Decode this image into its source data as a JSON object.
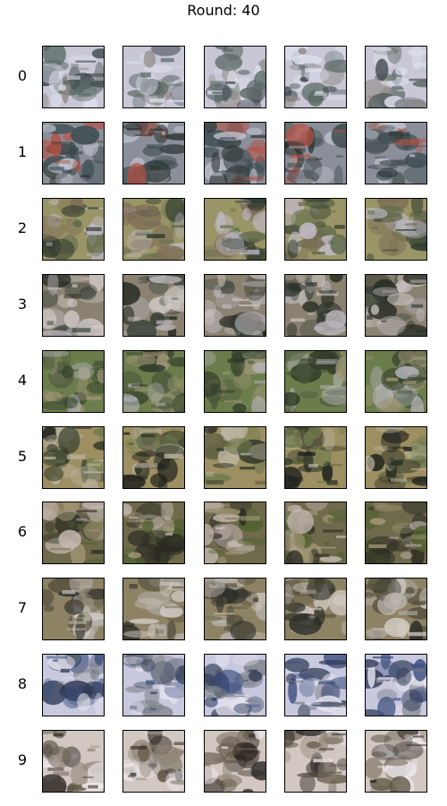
{
  "title": "Round: 40",
  "row_labels": [
    "0",
    "1",
    "2",
    "3",
    "4",
    "5",
    "6",
    "7",
    "8",
    "9"
  ],
  "columns": 5,
  "row_palettes": [
    [
      "#c9c6d6",
      "#3f4a4e",
      "#8f8a86",
      "#dfe2ee",
      "#5a6a66"
    ],
    [
      "#8b8f9a",
      "#3b4b4f",
      "#c8ccd8",
      "#2d3634",
      "#b65043"
    ],
    [
      "#9a9566",
      "#5e6a4a",
      "#c3bccb",
      "#7d6d58",
      "#2f3a2e"
    ],
    [
      "#8a8171",
      "#37423a",
      "#b8b3b8",
      "#262b22",
      "#cfc8c4"
    ],
    [
      "#6c7d4c",
      "#2f3b28",
      "#9e9576",
      "#48553a",
      "#b9b8c0"
    ],
    [
      "#9d8f61",
      "#2f3628",
      "#bdb5a2",
      "#1c1e1c",
      "#6e7a4d"
    ],
    [
      "#6f6a4b",
      "#2a2a22",
      "#a39777",
      "#51612f",
      "#c7b9b3"
    ],
    [
      "#8d8264",
      "#2b2d28",
      "#b7b1ad",
      "#55503d",
      "#d2cbc4"
    ],
    [
      "#c8c8de",
      "#3d4f7e",
      "#e4e3ef",
      "#7a7e85",
      "#2f3a55"
    ],
    [
      "#d2c7c1",
      "#2b2622",
      "#8e8376",
      "#5d5444",
      "#eeeaee"
    ]
  ]
}
